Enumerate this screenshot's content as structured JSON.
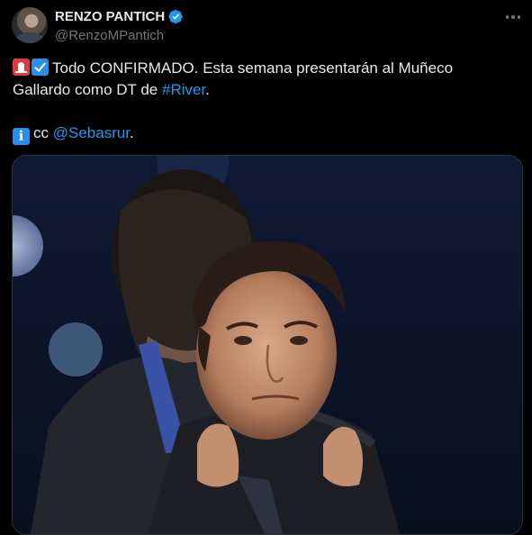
{
  "author": {
    "display_name": "RENZO PANTICH",
    "handle": "@RenzoMPantich",
    "verified": true
  },
  "icons": {
    "verified": "verified-badge-icon",
    "more": "more-options-icon",
    "emoji_1": "police-siren-emoji",
    "emoji_2": "check-box-emoji",
    "emoji_3": "information-emoji"
  },
  "tweet": {
    "line1_text": "Todo CONFIRMADO. Esta semana presentarán al Muñeco",
    "line2_text": "Gallardo como DT de ",
    "hashtag": "#River",
    "line2_end": ".",
    "line3_prefix": "cc ",
    "mention": "@Sebasrur",
    "line3_end": ".",
    "info_glyph": "i"
  },
  "colors": {
    "background": "#000000",
    "text": "#e7e9ea",
    "secondary": "#71767b",
    "link": "#1d9bf0",
    "verified": "#1d9bf0"
  }
}
